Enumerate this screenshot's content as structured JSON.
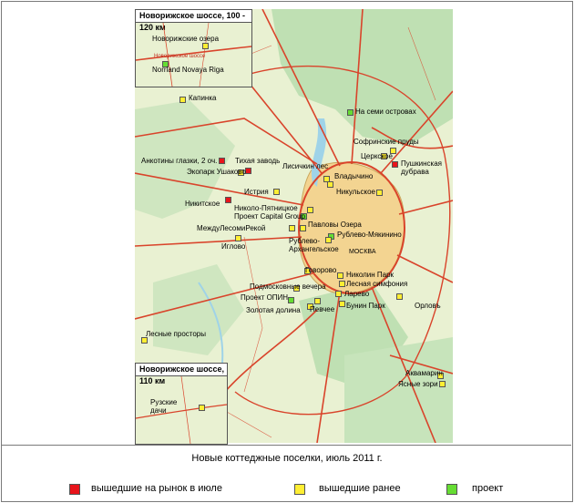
{
  "colors": {
    "july": "#e8141b",
    "earlier": "#ffee33",
    "project": "#66dd33",
    "forest": "#bfe0b3",
    "field": "#e9f1d2",
    "road": "#d9442b",
    "city": "#f3d491",
    "water": "#9fd3e8"
  },
  "map": {
    "city_label": "МОСКВА",
    "places": [
      {
        "name": "Капинка",
        "status": "earlier"
      },
      {
        "name": "На семи островах",
        "status": "project"
      },
      {
        "name": "Софринские пруды",
        "status": "earlier"
      },
      {
        "name": "Церкское",
        "status": "earlier"
      },
      {
        "name": "Пушкинская дубрава",
        "status": "july"
      },
      {
        "name": "Анкотины глазки, 2 оч.",
        "status": "july"
      },
      {
        "name": "Тихая заводь",
        "status": "july"
      },
      {
        "name": "Экопарк Ушаково",
        "status": "earlier"
      },
      {
        "name": "Лисичкин лес",
        "status": "earlier"
      },
      {
        "name": "Владычино",
        "status": "earlier"
      },
      {
        "name": "Никульское",
        "status": "earlier"
      },
      {
        "name": "Истрия",
        "status": "earlier"
      },
      {
        "name": "Никитское",
        "status": "july"
      },
      {
        "name": "Николо-Пятницкое",
        "status": "earlier"
      },
      {
        "name": "Проект Capital Group",
        "status": "project"
      },
      {
        "name": "МеждуЛесомиРекой",
        "status": "earlier"
      },
      {
        "name": "Павловы Озера",
        "status": "earlier"
      },
      {
        "name": "Рублево-Мякинино",
        "status": "project"
      },
      {
        "name": "Рублево-Архангельское",
        "status": "earlier"
      },
      {
        "name": "Иглово",
        "status": "earlier"
      },
      {
        "name": "Говорово",
        "status": "earlier"
      },
      {
        "name": "Николин Парк",
        "status": "earlier"
      },
      {
        "name": "Лесная симфония",
        "status": "earlier"
      },
      {
        "name": "Подмосковные вечера",
        "status": "earlier"
      },
      {
        "name": "Ларево",
        "status": "earlier"
      },
      {
        "name": "Проект ОПИН",
        "status": "project"
      },
      {
        "name": "Орловъ",
        "status": "earlier"
      },
      {
        "name": "Бунин Парк",
        "status": "earlier"
      },
      {
        "name": "Золотая долина",
        "status": "earlier"
      },
      {
        "name": "Певчее",
        "status": "earlier"
      },
      {
        "name": "Лесные просторы",
        "status": "earlier"
      },
      {
        "name": "Аквамарин",
        "status": "earlier"
      },
      {
        "name": "Ясные зори",
        "status": "earlier"
      }
    ]
  },
  "inset_top": {
    "title": "Новорижское шоссе, 100 - 120 км",
    "road_label": "Новорижское шоссе",
    "places": [
      {
        "name": "Новорижские озера",
        "status": "earlier"
      },
      {
        "name": "Norrland Novaya Riga",
        "status": "project"
      }
    ]
  },
  "inset_bottom": {
    "title": "Новорижское шоссе, 110 км",
    "places": [
      {
        "name": "Рузские дачи",
        "status": "earlier"
      }
    ]
  },
  "footer": {
    "title": "Новые коттеджные поселки, июль 2011 г.",
    "legend": [
      {
        "label": "вышедшие на рынок в июле",
        "status": "july"
      },
      {
        "label": "вышедшие ранее",
        "status": "earlier"
      },
      {
        "label": "проект",
        "status": "project"
      }
    ]
  }
}
